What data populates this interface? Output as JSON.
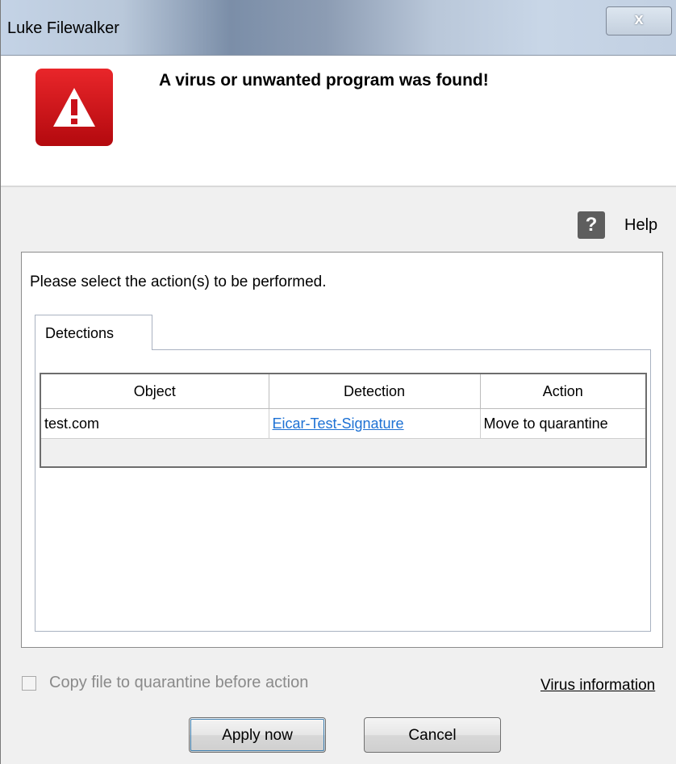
{
  "window": {
    "title": "Luke Filewalker",
    "close_glyph": "x"
  },
  "header": {
    "message": "A virus or unwanted program was found!",
    "warning_icon": "warning-triangle-icon",
    "warning_color": "#d71a1e"
  },
  "help": {
    "icon_glyph": "?",
    "label": "Help"
  },
  "main": {
    "instruction": "Please select the action(s) to be performed.",
    "tabs": [
      {
        "label": "Detections",
        "selected": true
      }
    ],
    "table": {
      "columns": [
        "Object",
        "Detection",
        "Action"
      ],
      "rows": [
        {
          "object": "test.com",
          "detection": "Eicar-Test-Signature",
          "action": "Move to quarantine"
        }
      ],
      "link_color": "#1d71d4"
    }
  },
  "footer": {
    "checkbox_label": "Copy file to quarantine before action",
    "checkbox_checked": false,
    "checkbox_enabled": false,
    "virus_info_link": "Virus information",
    "apply_button": "Apply now",
    "cancel_button": "Cancel"
  }
}
